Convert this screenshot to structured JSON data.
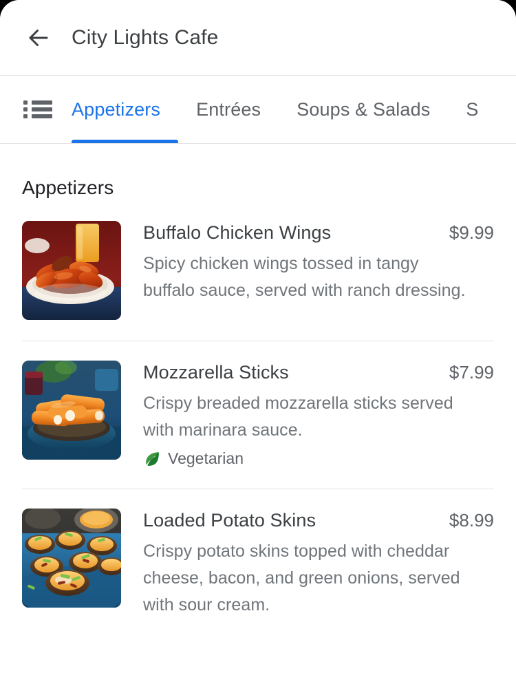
{
  "header": {
    "back_icon": "arrow-back-icon",
    "title": "City Lights Cafe"
  },
  "tab_bar": {
    "list_icon": "list-view-icon",
    "active_tab": "Appetizers",
    "accent_color": "#1a73e8",
    "tabs": [
      {
        "label": "Appetizers",
        "active": true
      },
      {
        "label": "Entrées",
        "active": false
      },
      {
        "label": "Soups & Salads",
        "active": false
      },
      {
        "label": "S",
        "active": false
      }
    ]
  },
  "section": {
    "title": "Appetizers"
  },
  "menu_items": [
    {
      "name": "Buffalo Chicken Wings",
      "price": "$9.99",
      "description": "Spicy chicken wings tossed in tangy buffalo sauce, served with ranch dressing.",
      "image_alt": "buffalo-chicken-wings-photo",
      "badges": []
    },
    {
      "name": "Mozzarella Sticks",
      "price": "$7.99",
      "description": "Crispy breaded mozzarella sticks served with marinara sauce.",
      "image_alt": "mozzarella-sticks-photo",
      "badges": [
        {
          "icon": "leaf-icon",
          "label": "Vegetarian"
        }
      ]
    },
    {
      "name": "Loaded Potato Skins",
      "price": "$8.99",
      "description": "Crispy potato skins topped with cheddar cheese, bacon, and green onions, served with sour cream.",
      "image_alt": "loaded-potato-skins-photo",
      "badges": []
    }
  ],
  "colors": {
    "accent": "#1a73e8",
    "title_text": "#3c4043",
    "body_text": "#70757a",
    "divider": "#e4e4e6"
  }
}
